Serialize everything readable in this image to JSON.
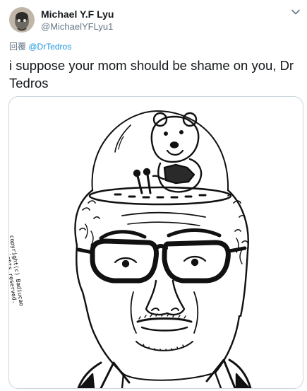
{
  "author": {
    "display_name": "Michael Y.F Lyu",
    "handle": "@MichaelYFLyu1"
  },
  "reply_to": {
    "prefix": "回覆",
    "handle": "@DrTedros"
  },
  "tweet": {
    "text": "i suppose your mom should be shame on you, Dr Tedros"
  },
  "media": {
    "credit_line_1": "copyright(c) Badiucao",
    "credit_line_2": "all rights reserved."
  },
  "icons": {
    "menu": "chevron-down-icon",
    "avatar": "avatar-image"
  }
}
